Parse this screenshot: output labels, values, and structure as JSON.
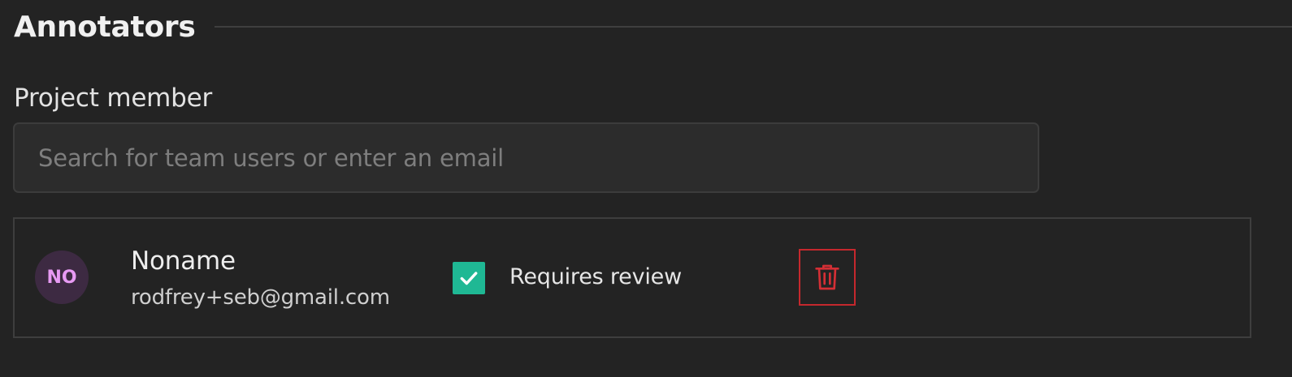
{
  "section": {
    "title": "Annotators"
  },
  "project_member": {
    "label": "Project member",
    "search_placeholder": "Search for team users or enter an email",
    "search_value": ""
  },
  "members": [
    {
      "initials": "NO",
      "name": "Noname",
      "email": "rodfrey+seb@gmail.com",
      "requires_review": {
        "checked": true,
        "label": "Requires review"
      },
      "delete_icon": "trash-icon"
    }
  ],
  "colors": {
    "background": "#232323",
    "avatar_bg": "#3d2a42",
    "avatar_text": "#e79af3",
    "checkbox": "#1fb894",
    "danger": "#c5282d"
  },
  "icons": {
    "checkbox": "check-icon",
    "delete": "trash-icon"
  }
}
